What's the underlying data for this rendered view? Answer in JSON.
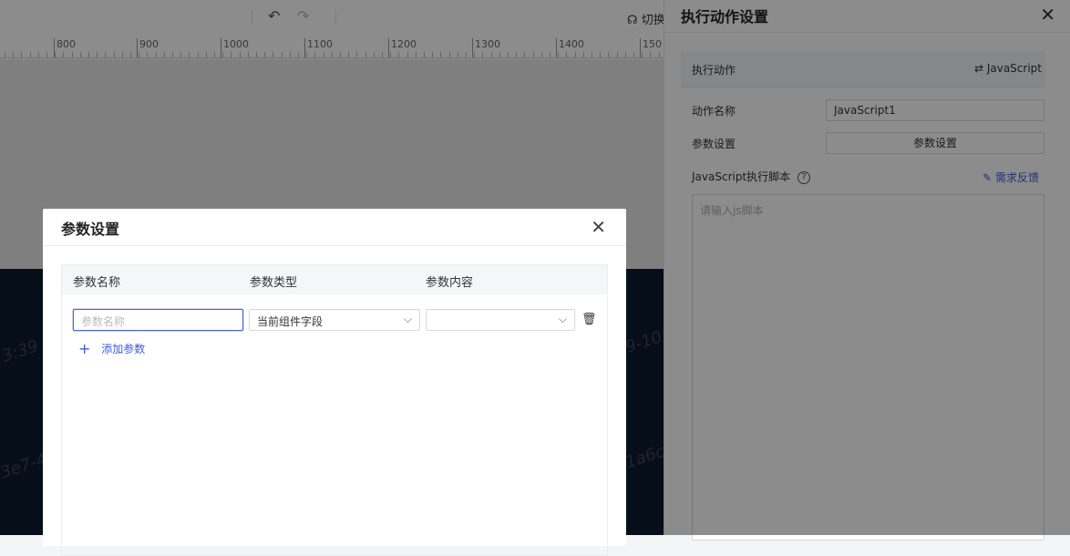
{
  "toolbar": {
    "undo_icon": "undo-icon",
    "redo_icon": "redo-icon",
    "switch_icon": "headset-icon",
    "switch_label": "切换"
  },
  "ruler": {
    "labels": [
      "800",
      "900",
      "1000",
      "1100",
      "1200",
      "1300",
      "1400",
      "150"
    ]
  },
  "canvas": {
    "watermarks": [
      "3:39",
      "9-10",
      "3e7-4",
      "1a6c"
    ]
  },
  "right_panel": {
    "title": "执行动作设置",
    "close_icon": "close-icon",
    "section_label": "执行动作",
    "switch_label": "⇄ JavaScript",
    "action_name_label": "动作名称",
    "action_name_value": "JavaScript1",
    "param_settings_label": "参数设置",
    "param_settings_button": "参数设置",
    "script_label": "JavaScript执行脚本",
    "help_icon": "?",
    "feedback_label": "需求反馈",
    "script_placeholder": "请输入js脚本"
  },
  "modal": {
    "title": "参数设置",
    "close_icon": "close-icon",
    "columns": [
      "参数名称",
      "参数类型",
      "参数内容"
    ],
    "rows": [
      {
        "name_placeholder": "参数名称",
        "type_value": "当前组件字段",
        "content_value": ""
      }
    ],
    "add_param_label": "添加参数"
  },
  "colors": {
    "accent": "#3b5bdb",
    "dark_canvas": "#0b1a2e",
    "overlay": "rgba(0,0,0,0.45)"
  }
}
